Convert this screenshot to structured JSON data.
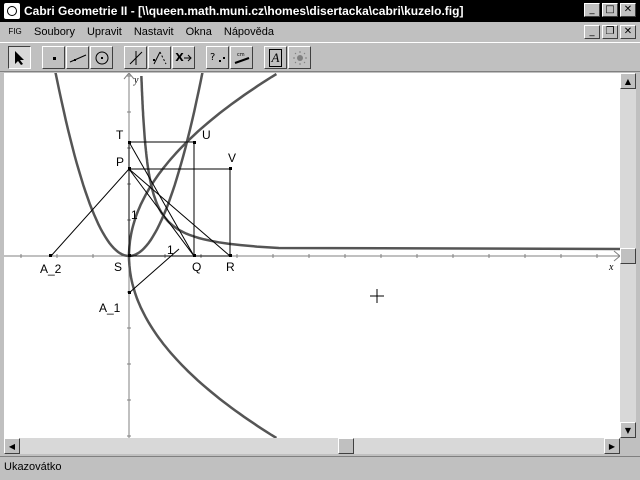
{
  "window": {
    "title": "Cabri Geometrie II - [\\\\queen.math.muni.cz\\homes\\disertacka\\cabri\\kuzelo.fig]",
    "minimize_glyph": "_",
    "maximize_glyph": "□",
    "close_glyph": "✕",
    "restore_glyph": "❐"
  },
  "menu": {
    "doc_icon_label": "FIG",
    "items": [
      "Soubory",
      "Upravit",
      "Nastavit",
      "Okna",
      "Nápověda"
    ]
  },
  "toolbar": {
    "text_tool_label": "A",
    "perp_tool_label": "X"
  },
  "canvas": {
    "axis_x_label": "x",
    "axis_y_label": "y",
    "points": {
      "T": "T",
      "U": "U",
      "P": "P",
      "V": "V",
      "S": "S",
      "Q": "Q",
      "R": "R",
      "A2": "A_2",
      "A1": "A_1"
    },
    "unit_x": "1",
    "unit_y": "1"
  },
  "status": {
    "text": "Ukazovátko"
  }
}
